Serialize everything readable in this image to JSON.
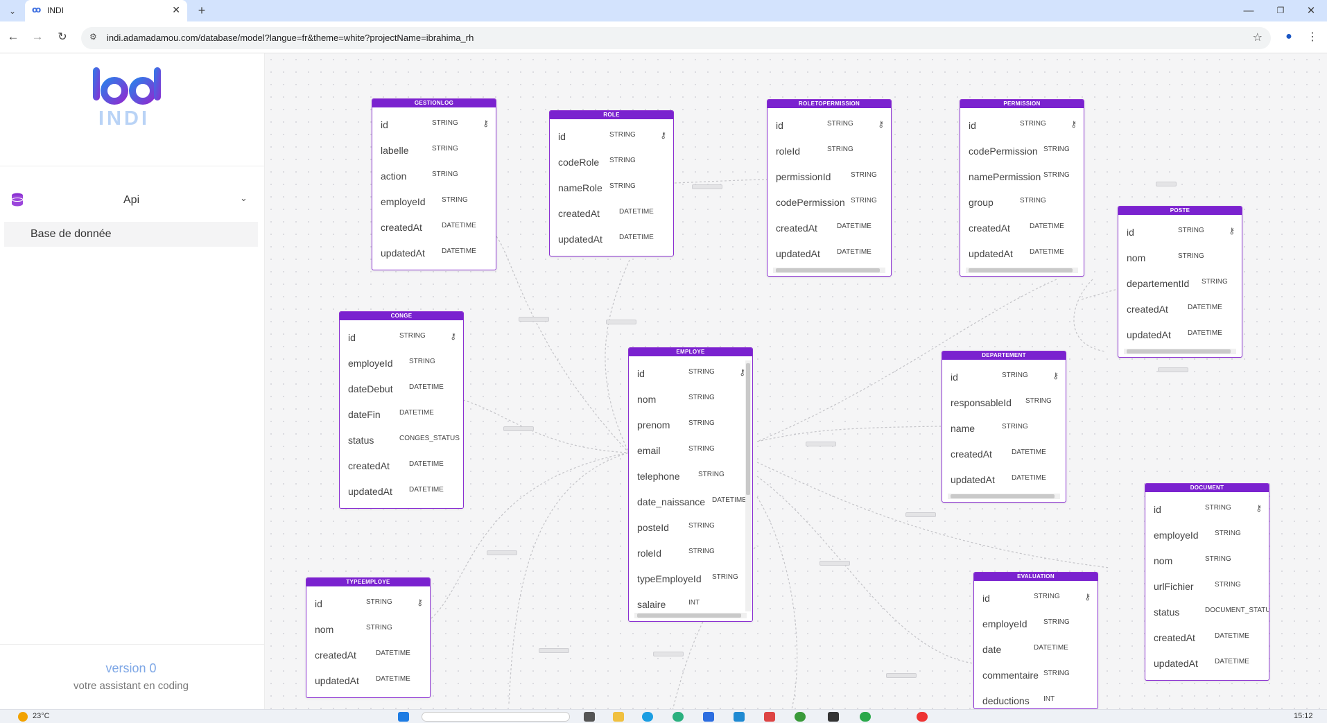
{
  "browser": {
    "tab_title": "INDI",
    "url": "indi.adamadamou.com/database/model?langue=fr&theme=white?projectName=ibrahima_rh"
  },
  "sidebar": {
    "logo_text": "INDI",
    "api_label": "Api",
    "item_label": "Base de donnée",
    "version": "version 0",
    "tagline": "votre assistant en coding"
  },
  "taskbar": {
    "weather": "23°C",
    "time": "15:12"
  },
  "tables": {
    "gestionlog": {
      "name": "GESTIONLOG",
      "fields": [
        [
          "id",
          "STRING"
        ],
        [
          "labelle",
          "STRING"
        ],
        [
          "action",
          "STRING"
        ],
        [
          "employeId",
          "STRING"
        ],
        [
          "createdAt",
          "DATETIME"
        ],
        [
          "updatedAt",
          "DATETIME"
        ]
      ]
    },
    "role": {
      "name": "ROLE",
      "fields": [
        [
          "id",
          "STRING"
        ],
        [
          "codeRole",
          "STRING"
        ],
        [
          "nameRole",
          "STRING"
        ],
        [
          "createdAt",
          "DATETIME"
        ],
        [
          "updatedAt",
          "DATETIME"
        ]
      ]
    },
    "roletopermission": {
      "name": "ROLETOPERMISSION",
      "fields": [
        [
          "id",
          "STRING"
        ],
        [
          "roleId",
          "STRING"
        ],
        [
          "permissionId",
          "STRING"
        ],
        [
          "codePermission",
          "STRING"
        ],
        [
          "createdAt",
          "DATETIME"
        ],
        [
          "updatedAt",
          "DATETIME"
        ]
      ]
    },
    "permission": {
      "name": "PERMISSION",
      "fields": [
        [
          "id",
          "STRING"
        ],
        [
          "codePermission",
          "STRING"
        ],
        [
          "namePermission",
          "STRING"
        ],
        [
          "group",
          "STRING"
        ],
        [
          "createdAt",
          "DATETIME"
        ],
        [
          "updatedAt",
          "DATETIME"
        ]
      ]
    },
    "poste": {
      "name": "POSTE",
      "fields": [
        [
          "id",
          "STRING"
        ],
        [
          "nom",
          "STRING"
        ],
        [
          "departementId",
          "STRING"
        ],
        [
          "createdAt",
          "DATETIME"
        ],
        [
          "updatedAt",
          "DATETIME"
        ]
      ]
    },
    "conge": {
      "name": "CONGE",
      "fields": [
        [
          "id",
          "STRING"
        ],
        [
          "employeId",
          "STRING"
        ],
        [
          "dateDebut",
          "DATETIME"
        ],
        [
          "dateFin",
          "DATETIME"
        ],
        [
          "status",
          "CONGES_STATUS"
        ],
        [
          "createdAt",
          "DATETIME"
        ],
        [
          "updatedAt",
          "DATETIME"
        ]
      ]
    },
    "employe": {
      "name": "EMPLOYE",
      "fields": [
        [
          "id",
          "STRING"
        ],
        [
          "nom",
          "STRING"
        ],
        [
          "prenom",
          "STRING"
        ],
        [
          "email",
          "STRING"
        ],
        [
          "telephone",
          "STRING"
        ],
        [
          "date_naissance",
          "DATETIME"
        ],
        [
          "posteId",
          "STRING"
        ],
        [
          "roleId",
          "STRING"
        ],
        [
          "typeEmployeId",
          "STRING"
        ],
        [
          "salaire",
          "INT"
        ]
      ]
    },
    "departement": {
      "name": "DEPARTEMENT",
      "fields": [
        [
          "id",
          "STRING"
        ],
        [
          "responsableId",
          "STRING"
        ],
        [
          "name",
          "STRING"
        ],
        [
          "createdAt",
          "DATETIME"
        ],
        [
          "updatedAt",
          "DATETIME"
        ]
      ]
    },
    "typeemploye": {
      "name": "TYPEEMPLOYE",
      "fields": [
        [
          "id",
          "STRING"
        ],
        [
          "nom",
          "STRING"
        ],
        [
          "createdAt",
          "DATETIME"
        ],
        [
          "updatedAt",
          "DATETIME"
        ]
      ]
    },
    "evaluation": {
      "name": "EVALUATION",
      "fields": [
        [
          "id",
          "STRING"
        ],
        [
          "employeId",
          "STRING"
        ],
        [
          "date",
          "DATETIME"
        ],
        [
          "commentaire",
          "STRING"
        ],
        [
          "deductions",
          "INT"
        ]
      ]
    },
    "document": {
      "name": "DOCUMENT",
      "fields": [
        [
          "id",
          "STRING"
        ],
        [
          "employeId",
          "STRING"
        ],
        [
          "nom",
          "STRING"
        ],
        [
          "urlFichier",
          "STRING"
        ],
        [
          "status",
          "DOCUMENT_STATUS"
        ],
        [
          "createdAt",
          "DATETIME"
        ],
        [
          "updatedAt",
          "DATETIME"
        ]
      ]
    }
  }
}
